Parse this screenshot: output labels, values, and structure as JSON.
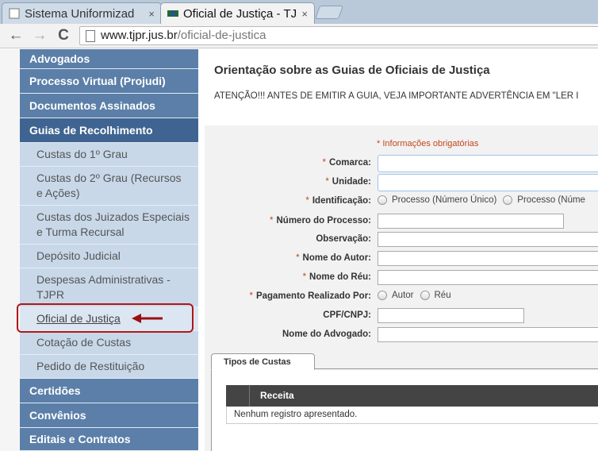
{
  "browser": {
    "tabs": [
      {
        "title": "Sistema Uniformizad",
        "close": "×"
      },
      {
        "title": "Oficial de Justiça - TJ",
        "close": "×"
      }
    ],
    "url_host": "www.tjpr.jus.br",
    "url_path": "/oficial-de-justica",
    "back": "←",
    "forward": "→",
    "reload": "C"
  },
  "sidebar": {
    "items_top": [
      "Advogados",
      "Processo Virtual (Projudi)",
      "Documentos Assinados",
      "Guias de Recolhimento"
    ],
    "sub_items": [
      "Custas do 1º Grau",
      "Custas do 2º Grau (Recursos e Ações)",
      "Custas dos Juizados Especiais e Turma Recursal",
      "Depósito Judicial",
      "Despesas Administrativas - TJPR",
      "Oficial de Justiça",
      "Cotação de Custas",
      "Pedido de Restituição"
    ],
    "items_bottom": [
      "Certidões",
      "Convênios",
      "Editais e Contratos"
    ]
  },
  "main": {
    "title": "Orientação sobre as Guias de Oficiais de Justiça",
    "warning": "ATENÇÃO!!! ANTES DE EMITIR A GUIA, VEJA IMPORTANTE ADVERTÊNCIA EM \"LER I",
    "required_note": "* Informações obrigatórias",
    "asterisk": "*",
    "labels": {
      "comarca": "Comarca:",
      "unidade": "Unidade:",
      "identificacao": "Identificação:",
      "numero_processo": "Número do Processo:",
      "observacao": "Observação:",
      "nome_autor": "Nome do Autor:",
      "nome_reu": "Nome do Réu:",
      "pagamento": "Pagamento Realizado Por:",
      "cpf_cnpj": "CPF/CNPJ:",
      "nome_advogado": "Nome do Advogado:"
    },
    "identificacao_options": [
      "Processo (Número Único)",
      "Processo (Núme"
    ],
    "pagamento_options": [
      "Autor",
      "Réu"
    ],
    "tab_label": "Tipos de Custas",
    "grid_header": "Receita",
    "grid_empty": "Nenhum registro apresentado."
  },
  "colors": {
    "menu_main": "#5b7fa8",
    "menu_current": "#3f6491",
    "menu_sub": "#c8d8e9",
    "required": "#c4461d",
    "highlight": "#b01717"
  }
}
